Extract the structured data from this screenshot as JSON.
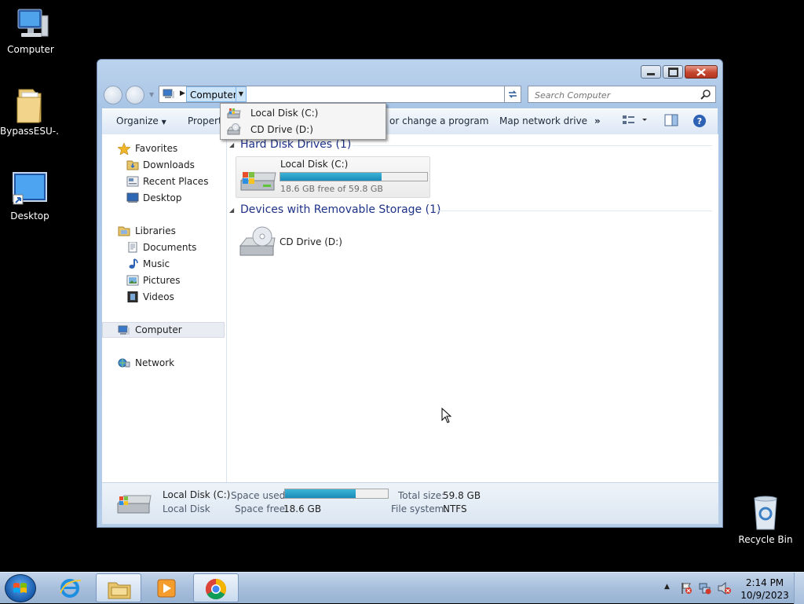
{
  "desktop": {
    "icons": [
      {
        "label": "Computer"
      },
      {
        "label": "BypassESU-..."
      },
      {
        "label": "Desktop"
      },
      {
        "label": "Recycle Bin"
      }
    ]
  },
  "window": {
    "address": {
      "crumb": "Computer"
    },
    "search": {
      "placeholder": "Search Computer"
    },
    "toolbar": {
      "organize": "Organize",
      "properties": "Properti",
      "uninstall": "or change a program",
      "map_drive": "Map network drive",
      "more": "»"
    },
    "nav": {
      "favorites": "Favorites",
      "downloads": "Downloads",
      "recent_places": "Recent Places",
      "desktop": "Desktop",
      "libraries": "Libraries",
      "documents": "Documents",
      "music": "Music",
      "pictures": "Pictures",
      "videos": "Videos",
      "computer": "Computer",
      "network": "Network"
    },
    "groups": {
      "hdd_header": "Hard Disk Drives (1)",
      "removable_header": "Devices with Removable Storage (1)"
    },
    "drives": {
      "c_name": "Local Disk (C:)",
      "c_space": "18.6 GB free of 59.8 GB",
      "c_used_fraction": 0.69,
      "d_name": "CD Drive (D:)"
    },
    "details": {
      "name": "Local Disk (C:)",
      "type": "Local Disk",
      "space_used_label": "Space used:",
      "space_free_label": "Space free:",
      "space_free": "18.6 GB",
      "total_size_label": "Total size:",
      "total_size": "59.8 GB",
      "file_system_label": "File system:",
      "file_system": "NTFS"
    }
  },
  "dropdown": {
    "items": [
      "Local Disk (C:)",
      "CD Drive (D:)"
    ]
  },
  "taskbar": {
    "time": "2:14 PM",
    "date": "10/9/2023"
  },
  "colors": {
    "desktop_bg": "#000000",
    "progress": "#1a8bb8",
    "group_header": "#1e3287"
  }
}
